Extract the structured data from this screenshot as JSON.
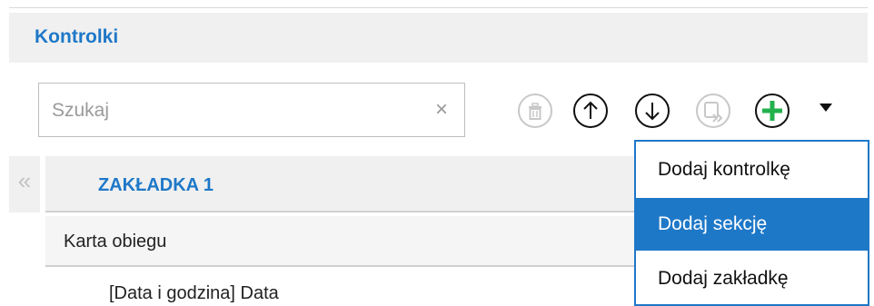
{
  "header": {
    "title": "Kontrolki"
  },
  "search": {
    "placeholder": "Szukaj",
    "value": "",
    "clear_glyph": "×"
  },
  "toolbar": {
    "buttons": [
      {
        "name": "delete-button",
        "icon": "trash-icon",
        "enabled": false
      },
      {
        "name": "move-up-button",
        "icon": "arrow-up-icon",
        "enabled": true
      },
      {
        "name": "move-down-button",
        "icon": "arrow-down-icon",
        "enabled": true
      },
      {
        "name": "move-to-button",
        "icon": "move-to-icon",
        "enabled": false
      },
      {
        "name": "add-button",
        "icon": "plus-icon",
        "enabled": true
      }
    ],
    "dropdown_icon": "caret-down-icon"
  },
  "tree": {
    "collapse_glyph": "«",
    "tab_label": "ZAKŁADKA 1",
    "section_label": "Karta obiegu",
    "field_label": "[Data i godzina] Data"
  },
  "menu": {
    "items": [
      {
        "label": "Dodaj kontrolkę",
        "active": false
      },
      {
        "label": "Dodaj sekcję",
        "active": true
      },
      {
        "label": "Dodaj zakładkę",
        "active": false
      }
    ]
  },
  "colors": {
    "accent": "#1e78c8",
    "add_green": "#22b14c",
    "disabled_gray": "#c8c8c8",
    "header_bg": "#f0f0f0"
  }
}
